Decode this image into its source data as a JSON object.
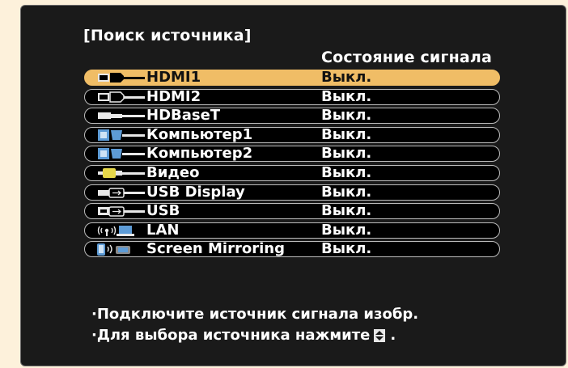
{
  "menu": {
    "title": "[Поиск источника]",
    "column_header": "Состояние сигнала",
    "selected_index": 0,
    "sources": [
      {
        "label": "HDMI1",
        "status": "Выкл.",
        "icon": "hdmi-icon"
      },
      {
        "label": "HDMI2",
        "status": "Выкл.",
        "icon": "hdmi-icon"
      },
      {
        "label": "HDBaseT",
        "status": "Выкл.",
        "icon": "hdbaset-icon"
      },
      {
        "label": "Компьютер1",
        "status": "Выкл.",
        "icon": "vga-computer-icon"
      },
      {
        "label": "Компьютер2",
        "status": "Выкл.",
        "icon": "vga-computer-icon"
      },
      {
        "label": "Видео",
        "status": "Выкл.",
        "icon": "video-rca-icon"
      },
      {
        "label": "USB Display",
        "status": "Выкл.",
        "icon": "usb-display-icon"
      },
      {
        "label": "USB",
        "status": "Выкл.",
        "icon": "usb-icon"
      },
      {
        "label": "LAN",
        "status": "Выкл.",
        "icon": "lan-wifi-icon"
      },
      {
        "label": "Screen Mirroring",
        "status": "Выкл.",
        "icon": "screen-mirroring-icon"
      }
    ]
  },
  "footer": {
    "line1": "·Подключите источник сигнала изобр.",
    "line2_prefix": "·Для выбора источника нажмите",
    "line2_suffix": ".",
    "nav_icon": "up-down-arrow-icon"
  },
  "colors": {
    "page_background": "#fdf1db",
    "panel_background": "#1a1a1a",
    "selection": "#f0bd66",
    "text": "#ffffff"
  }
}
